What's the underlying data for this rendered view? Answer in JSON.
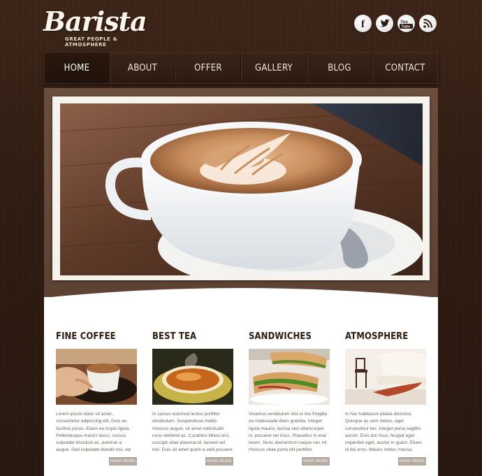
{
  "header": {
    "logo": "Barista",
    "tagline": "GREAT PEOPLE & ATMOSPHERE",
    "social": [
      {
        "icon": "facebook-icon",
        "glyph": "f"
      },
      {
        "icon": "twitter-icon",
        "glyph": "t"
      },
      {
        "icon": "youtube-icon",
        "glyph": "You Tube"
      },
      {
        "icon": "rss-icon",
        "glyph": "rss"
      }
    ]
  },
  "nav": {
    "items": [
      "HOME",
      "ABOUT",
      "OFFER",
      "GALLERY",
      "BLOG",
      "CONTACT"
    ],
    "active": 0
  },
  "slider": {
    "slides": 4,
    "active": 0
  },
  "features": [
    {
      "title": "FINE COFFEE",
      "text": "Lorem ipsum dolor sit amet, consectetur adipiscing elit. Duis eu facilisis purus. Etiam eu turpis ligula. Pellentesque mauris lacus, cursus vulputate tincidunt ac, pulvinar a augue. Sed vulputate blandit nisi, vel auctor purus luctus ut.",
      "button": "READ MORE"
    },
    {
      "title": "BEST TEA",
      "text": "In cursus euismod lectus porttitor vestibulum. Suspendisse mattis rhoncus augue, sit amet sollicitudin nunc eleifend ac. Curabitur libero orci, suscipit vitae placerat id, laoreet vel nisl. Duis sit amet quam a velit posuere consequat.",
      "button": "READ MORE"
    },
    {
      "title": "SANDWICHES",
      "text": "Vivamus vestibulum nisl ut nisi fringilla eu malesuada diam gravida. Integer ligula mauris, lacinia sed ullamcorper in, posuere vel risus. Phasellus in erat lorem. Nunc elementum neque nec mi rhoncus vitae porta elit porttitor.",
      "button": "READ MORE"
    },
    {
      "title": "ATMOSPHERE",
      "text": "In hac habitasse platea dictumst. Quisque ac sem metus, eget consectetur leo. Integer porta sagittis auctor. Duis dui risus, feugiat eget imperdiet eget, auctor in quam. Etiam id dui eros. Mauris metus massa, hendrerit mattis scelerisque.",
      "button": "READ MORE"
    }
  ],
  "colors": {
    "background": "#2f1b11",
    "nav": "#2c1a11",
    "frame": "#5c4132",
    "title_text": "#2d1a10",
    "body_text": "#6e6259",
    "button": "#b6aaa0"
  }
}
